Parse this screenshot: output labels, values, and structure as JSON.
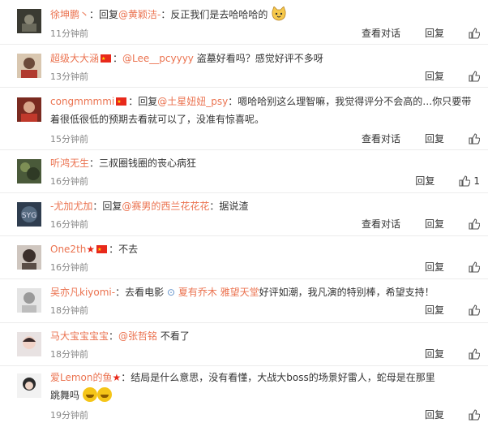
{
  "comments": [
    {
      "user": "徐坤鹏丶",
      "flag": false,
      "star": false,
      "prefix": "：回复",
      "mention": "@黄颖洁-",
      "text": "：反正我们是去哈哈哈的",
      "emoji": "cat",
      "time": "11分钟前",
      "view": "查看对话",
      "reply": "回复",
      "likes": ""
    },
    {
      "user": "超级大大涵",
      "flag": true,
      "star": false,
      "prefix": "：",
      "mention": "@Lee__pcyyyy",
      "text": " 盗墓好看吗？感觉好评不多呀",
      "emoji": "",
      "time": "13分钟前",
      "view": "",
      "reply": "回复",
      "likes": ""
    },
    {
      "user": "congmmmmi",
      "flag": true,
      "star": false,
      "prefix": "：回复",
      "mention": "@土星妞妞_psy",
      "text": "：嗯哈哈别这么理智嘛，我觉得评分不会高的…你只要带着很低很低的预期去看就可以了，没准有惊喜呢。",
      "emoji": "",
      "time": "15分钟前",
      "view": "查看对话",
      "reply": "回复",
      "likes": ""
    },
    {
      "user": "听鸿无生",
      "flag": false,
      "star": false,
      "prefix": "：",
      "mention": "",
      "text": "三叔圈钱圈的丧心病狂",
      "emoji": "",
      "time": "16分钟前",
      "view": "",
      "reply": "回复",
      "likes": "1"
    },
    {
      "user": "-尤加尤加",
      "flag": false,
      "star": false,
      "prefix": "：回复",
      "mention": "@赛男的西兰花花花",
      "text": "：据说渣",
      "emoji": "",
      "time": "16分钟前",
      "view": "查看对话",
      "reply": "回复",
      "likes": ""
    },
    {
      "user": "One2th",
      "flag": true,
      "star": true,
      "prefix": "：",
      "mention": "",
      "text": "不去",
      "emoji": "",
      "time": "16分钟前",
      "view": "",
      "reply": "回复",
      "likes": ""
    },
    {
      "user": "吴亦凡kiyomi-",
      "flag": false,
      "star": false,
      "prefix": "：",
      "mention": "",
      "text": "去看电影 ",
      "topic": "夏有乔木 雅望天堂",
      "text2": "好评如潮，我凡演的特别棒，希望支持！",
      "emoji": "",
      "time": "18分钟前",
      "view": "",
      "reply": "回复",
      "likes": ""
    },
    {
      "user": "马大宝宝宝宝",
      "flag": false,
      "star": false,
      "prefix": "：",
      "mention": "@张哲铭",
      "text": " 不看了",
      "emoji": "",
      "time": "18分钟前",
      "view": "",
      "reply": "回复",
      "likes": ""
    },
    {
      "user": "爱Lemon的鱼",
      "flag": false,
      "star": true,
      "prefix": "：",
      "mention": "",
      "text": "结局是什么意思，没有看懂，大战大boss的场景好雷人，蛇母是在那里跳舞吗",
      "emoji": "laugh",
      "time": "19分钟前",
      "view": "",
      "reply": "回复",
      "likes": ""
    }
  ],
  "colors": {
    "link": "#eb7350",
    "time": "#888888",
    "flag": "#e8291b"
  }
}
